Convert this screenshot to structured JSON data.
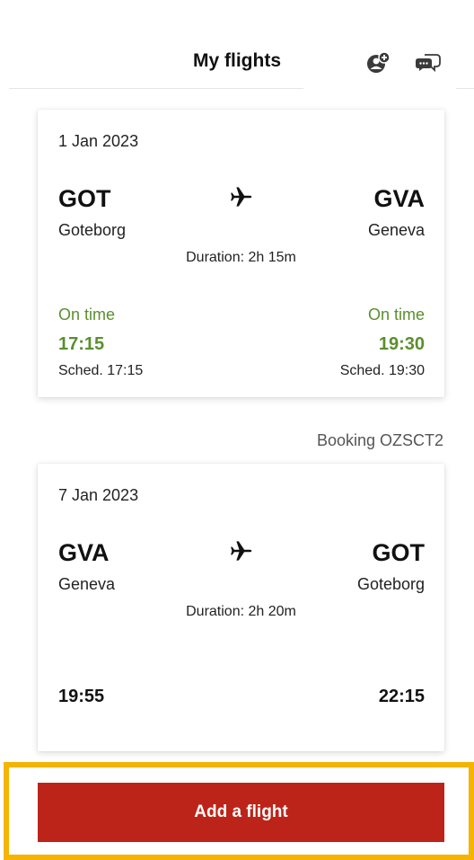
{
  "header": {
    "title": "My flights",
    "icons": [
      "add-user-icon",
      "chat-icon"
    ]
  },
  "flights": [
    {
      "date": "1 Jan 2023",
      "origin_code": "GOT",
      "origin_city": "Goteborg",
      "destination_code": "GVA",
      "destination_city": "Geneva",
      "duration": "Duration: 2h 15m",
      "departure_status": "On time",
      "arrival_status": "On time",
      "departure_time": "17:15",
      "arrival_time": "19:30",
      "departure_sched": "Sched. 17:15",
      "arrival_sched": "Sched. 19:30"
    },
    {
      "date": "7 Jan 2023",
      "origin_code": "GVA",
      "origin_city": "Geneva",
      "destination_code": "GOT",
      "destination_city": "Goteborg",
      "duration": "Duration: 2h 20m",
      "departure_time": "19:55",
      "arrival_time": "22:15"
    }
  ],
  "booking_label": "Booking OZSCT2",
  "actions": {
    "add_flight_label": "Add a flight"
  },
  "colors": {
    "on_time_green": "#5a8f2e",
    "primary_red": "#bd2419",
    "highlight_yellow": "#f4b400"
  }
}
